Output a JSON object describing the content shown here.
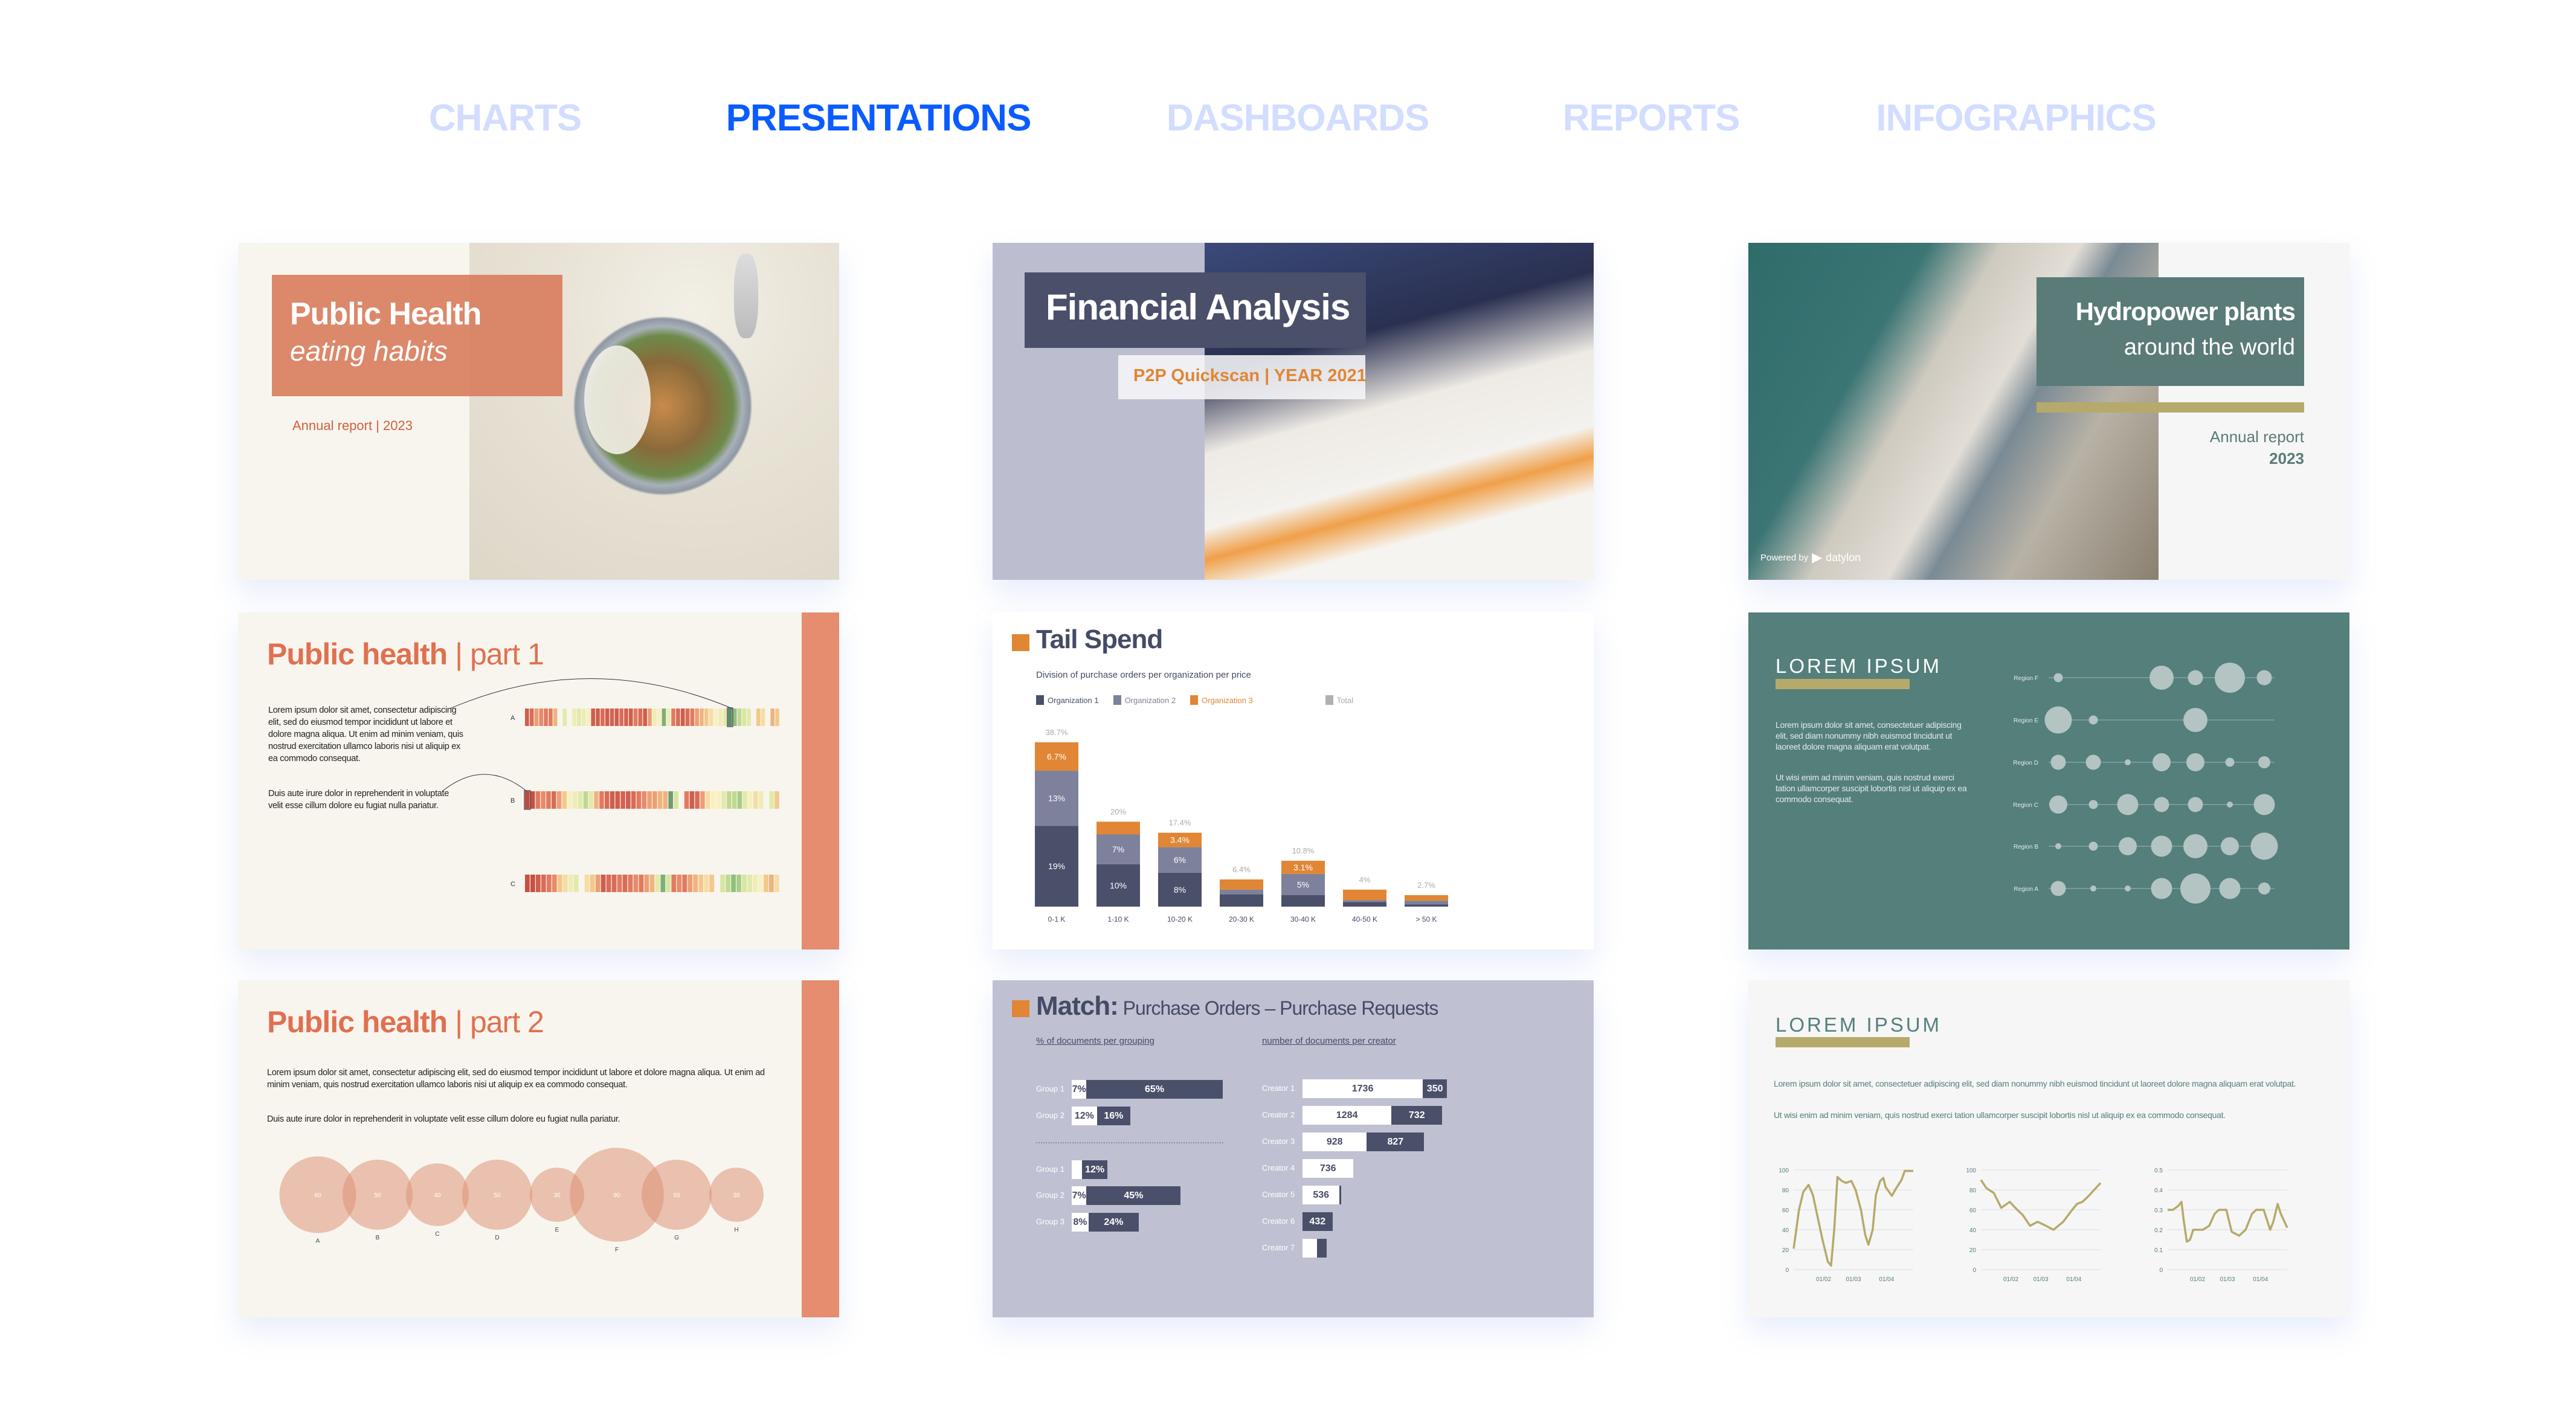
{
  "nav": {
    "tabs": [
      {
        "label": "CHARTS",
        "active": false
      },
      {
        "label": "PRESENTATIONS",
        "active": true
      },
      {
        "label": "DASHBOARDS",
        "active": false
      },
      {
        "label": "REPORTS",
        "active": false
      },
      {
        "label": "INFOGRAPHICS",
        "active": false
      }
    ],
    "active_color": "#0a5cff",
    "inactive_color": "#d2ddff"
  },
  "cards": {
    "public_health_cover": {
      "title": "Public Health",
      "subtitle": "eating habits",
      "footer": "Annual report | 2023",
      "accent": "#d97e5e"
    },
    "financial_analysis": {
      "title": "Financial Analysis",
      "subtitle": "P2P Quickscan | YEAR 2021",
      "accent": "#4a4f6a"
    },
    "hydropower": {
      "title": "Hydropower plants",
      "subtitle": "around the world",
      "report": "Annual report",
      "year": "2023",
      "powered_by": "Powered by",
      "brand": "datylon",
      "accent": "#5a7b77"
    },
    "part1": {
      "title_bold": "Public health",
      "title_rest": " | part 1",
      "paragraphs": [
        "Lorem ipsum dolor sit amet, consectetur adipiscing elit, sed do eiusmod tempor incididunt ut labore et dolore magna aliqua. Ut enim ad minim veniam, quis nostrud exercitation ullamco laboris nisi ut aliquip ex ea commodo consequat.",
        "Duis aute irure dolor in reprehenderit in voluptate velit esse cillum dolore eu fugiat nulla pariatur."
      ]
    },
    "tail_spend": {
      "title": "Tail Spend",
      "subtitle": "Division of purchase orders per organization per price"
    },
    "match": {
      "title_bold": "Match:",
      "title_rest": " Purchase Orders – Purchase Requests",
      "left_heading": "% of documents per grouping",
      "right_heading": "number of documents per creator"
    },
    "lorem_dots": {
      "title": "LOREM IPSUM",
      "paragraphs": [
        "Lorem ipsum dolor sit amet, consectetuer adipiscing elit, sed diam nonummy nibh euismod tincidunt ut laoreet dolore magna aliquam erat volutpat.",
        "Ut wisi enim ad minim veniam, quis nostrud exerci tation ullamcorper suscipit lobortis nisl ut aliquip ex ea commodo consequat."
      ]
    },
    "lorem_lines": {
      "title": "LOREM IPSUM",
      "paragraphs": [
        "Lorem ipsum dolor sit amet, consectetuer adipiscing elit, sed diam nonummy nibh euismod tincidunt ut laoreet dolore magna aliquam erat volutpat.",
        "Ut wisi enim ad minim veniam, quis nostrud exerci tation ullamcorper suscipit lobortis nisl ut aliquip ex ea commodo consequat."
      ]
    },
    "part2": {
      "title_bold": "Public health",
      "title_rest": " | part 2",
      "paragraphs": [
        "Lorem ipsum dolor sit amet, consectetur adipiscing elit, sed do eiusmod tempor incididunt ut labore et dolore magna aliqua. Ut enim ad minim veniam, quis nostrud exercitation ullamco laboris nisi ut aliquip ex ea commodo consequat.",
        "Duis aute irure dolor in reprehenderit in voluptate velit esse cillum dolore eu fugiat nulla pariatur."
      ]
    }
  },
  "chart_data": [
    {
      "id": "heatmap-stripes",
      "type": "heatmap",
      "rows": [
        {
          "label": "A",
          "highlight": 43,
          "values": [
            0.1,
            0.15,
            0.3,
            0.25,
            0.2,
            0.2,
            0.35,
            null,
            0.6,
            null,
            0.55,
            0.6,
            0.55,
            0.5,
            0.1,
            0.1,
            0.15,
            0.1,
            0.12,
            0.1,
            0.15,
            0.12,
            0.1,
            0.2,
            0.15,
            0.1,
            0.3,
            0.55,
            0.5,
            0.85,
            0.55,
            0.2,
            0.15,
            0.1,
            0.15,
            0.2,
            0.3,
            0.35,
            0.4,
            0.45,
            0.5,
            0.55,
            0.6,
            0.95,
            0.8,
            0.7,
            0.65,
            0.6,
            null,
            0.4,
            0.45,
            null,
            0.35,
            0.4
          ]
        },
        {
          "label": "B",
          "highlight": 0,
          "values": [
            0.02,
            0.05,
            0.2,
            0.25,
            0.2,
            0.15,
            0.3,
            0.4,
            0.5,
            0.55,
            0.6,
            0.7,
            0.6,
            0.35,
            0.2,
            0.15,
            0.1,
            0.1,
            0.12,
            0.1,
            0.15,
            0.2,
            0.25,
            0.3,
            0.3,
            0.35,
            0.35,
            0.9,
            0.65,
            null,
            0.2,
            0.1,
            0.15,
            0.3,
            0.45,
            0.5,
            0.5,
            0.6,
            0.7,
            0.7,
            0.75,
            0.6,
            0.5,
            0.45,
            0.55,
            null,
            0.6,
            0.4
          ]
        },
        {
          "label": "C",
          "highlight": null,
          "values": [
            0.05,
            0.05,
            0.1,
            0.15,
            0.2,
            0.25,
            0.4,
            0.45,
            0.55,
            0.6,
            null,
            0.45,
            0.4,
            0.3,
            0.1,
            0.15,
            0.15,
            0.2,
            0.15,
            0.2,
            0.25,
            0.2,
            0.3,
            0.35,
            0.6,
            0.85,
            0.65,
            0.2,
            0.25,
            0.2,
            0.3,
            0.35,
            0.4,
            0.45,
            0.4,
            null,
            0.65,
            0.7,
            0.8,
            0.75,
            0.65,
            0.6,
            0.55,
            0.5,
            0.4,
            0.35,
            0.45
          ]
        }
      ]
    },
    {
      "id": "tail-spend",
      "type": "bar",
      "stacked": true,
      "categories": [
        "0-1 K",
        "1-10 K",
        "10-20 K",
        "20-30 K",
        "30-40 K",
        "40-50 K",
        "> 50 K"
      ],
      "series": [
        {
          "name": "Organization 1",
          "color": "#4a4f6a",
          "values": [
            19,
            10,
            8,
            2.9,
            2.7,
            1.1,
            0.5
          ],
          "labels": [
            "19%",
            "10%",
            "8%",
            "",
            "",
            "",
            ""
          ]
        },
        {
          "name": "Organization 2",
          "color": "#7d819b",
          "values": [
            13,
            7,
            6,
            1.1,
            5,
            0.4,
            0.9
          ],
          "labels": [
            "13%",
            "7%",
            "6%",
            "",
            "5%",
            "",
            ""
          ]
        },
        {
          "name": "Organization 3",
          "color": "#e08634",
          "values": [
            6.7,
            3,
            3.4,
            2.4,
            3.1,
            2.5,
            1.3
          ],
          "labels": [
            "6.7%",
            "",
            "3.4%",
            "",
            "3.1%",
            "",
            ""
          ]
        }
      ],
      "totals": {
        "name": "Total",
        "color": "#b0b0b0",
        "labels": [
          "38.7%",
          "20%",
          "17.4%",
          "6.4%",
          "10.8%",
          "4%",
          "2.7%"
        ]
      },
      "legend": "top"
    },
    {
      "id": "match-groups",
      "type": "bar",
      "orientation": "horizontal",
      "stacked": true,
      "blocks": [
        [
          {
            "label": "Group 1",
            "values": [
              7,
              65
            ],
            "labels": [
              "7%",
              "65%"
            ]
          },
          {
            "label": "Group 2",
            "values": [
              12,
              16
            ],
            "labels": [
              "12%",
              "16%"
            ]
          }
        ],
        [
          {
            "label": "Group 1",
            "values": [
              5,
              12
            ],
            "labels": [
              "",
              "12%"
            ]
          },
          {
            "label": "Group 2",
            "values": [
              7,
              45
            ],
            "labels": [
              "7%",
              "45%"
            ]
          },
          {
            "label": "Group 3",
            "values": [
              8,
              24
            ],
            "labels": [
              "8%",
              "24%"
            ]
          }
        ]
      ]
    },
    {
      "id": "match-creators",
      "type": "bar",
      "orientation": "horizontal",
      "stacked": true,
      "rows": [
        {
          "label": "Creator 1",
          "values": [
            1736,
            350
          ],
          "labels": [
            "1736",
            "350"
          ]
        },
        {
          "label": "Creator 2",
          "values": [
            1284,
            732
          ],
          "labels": [
            "1284",
            "732"
          ]
        },
        {
          "label": "Creator 3",
          "values": [
            928,
            827
          ],
          "labels": [
            "928",
            "827"
          ]
        },
        {
          "label": "Creator 4",
          "values": [
            736,
            0
          ],
          "labels": [
            "736",
            ""
          ]
        },
        {
          "label": "Creator 5",
          "values": [
            536,
            25
          ],
          "labels": [
            "536",
            ""
          ]
        },
        {
          "label": "Creator 6",
          "values": [
            0,
            432
          ],
          "labels": [
            "",
            "432"
          ]
        },
        {
          "label": "Creator 7",
          "values": [
            210,
            135
          ],
          "labels": [
            "",
            ""
          ]
        }
      ]
    },
    {
      "id": "region-dots",
      "type": "scatter",
      "rows": [
        {
          "label": "Region F",
          "values": [
            3,
            null,
            null,
            8,
            5,
            10,
            5
          ]
        },
        {
          "label": "Region E",
          "values": [
            9,
            3,
            null,
            null,
            8,
            null,
            null
          ]
        },
        {
          "label": "Region D",
          "values": [
            5,
            5,
            2,
            6,
            6,
            3,
            4
          ]
        },
        {
          "label": "Region C",
          "values": [
            6,
            3,
            7,
            5,
            5,
            2,
            7
          ]
        },
        {
          "label": "Region B",
          "values": [
            2,
            3,
            6,
            7,
            8,
            6,
            9
          ]
        },
        {
          "label": "Region A",
          "values": [
            5,
            2,
            2,
            7,
            10,
            7,
            4
          ]
        }
      ],
      "color": "#b3c4c2"
    },
    {
      "id": "line-1",
      "type": "line",
      "ylim": [
        0,
        100
      ],
      "yticks": [
        "0",
        "20",
        "40",
        "60",
        "80",
        "100"
      ],
      "xticks": [
        "01/02",
        "01/03",
        "01/04"
      ],
      "color": "#b5aa6b",
      "grid": true,
      "points": [
        [
          "04/01",
          21
        ],
        [
          "09/01",
          60
        ],
        [
          "13/01",
          78
        ],
        [
          "18/01",
          85
        ],
        [
          "22/01",
          75
        ],
        [
          "26/01",
          55
        ],
        [
          "31/01",
          30
        ],
        [
          "05/02",
          8
        ],
        [
          "08/02",
          4
        ],
        [
          "11/02",
          40
        ],
        [
          "14/02",
          93
        ],
        [
          "18/02",
          89
        ],
        [
          "22/02",
          87
        ],
        [
          "27/02",
          89
        ],
        [
          "03/03",
          80
        ],
        [
          "08/03",
          60
        ],
        [
          "12/03",
          35
        ],
        [
          "15/03",
          25
        ],
        [
          "19/03",
          40
        ],
        [
          "22/03",
          75
        ],
        [
          "26/03",
          89
        ],
        [
          "29/03",
          92
        ],
        [
          "31/03",
          83
        ],
        [
          "06/04",
          74
        ],
        [
          "09/04",
          80
        ],
        [
          "15/04",
          90
        ],
        [
          "18/04",
          99
        ],
        [
          "26/04",
          99
        ]
      ]
    },
    {
      "id": "line-2",
      "type": "line",
      "ylim": [
        0,
        100
      ],
      "yticks": [
        "0",
        "20",
        "40",
        "60",
        "80",
        "100"
      ],
      "xticks": [
        "01/02",
        "01/03",
        "01/04"
      ],
      "color": "#b5aa6b",
      "grid": true,
      "points": [
        [
          "04/01",
          90
        ],
        [
          "09/01",
          82
        ],
        [
          "13/01",
          79
        ],
        [
          "16/01",
          77
        ],
        [
          "23/01",
          62
        ],
        [
          "31/01",
          68
        ],
        [
          "07/02",
          60
        ],
        [
          "12/02",
          55
        ],
        [
          "19/02",
          44
        ],
        [
          "26/02",
          48
        ],
        [
          "04/03",
          45
        ],
        [
          "13/03",
          40
        ],
        [
          "22/03",
          48
        ],
        [
          "29/03",
          58
        ],
        [
          "04/04",
          66
        ],
        [
          "09/04",
          68
        ],
        [
          "14/04",
          73
        ],
        [
          "20/04",
          80
        ],
        [
          "26/04",
          87
        ]
      ]
    },
    {
      "id": "line-3",
      "type": "line",
      "ylim": [
        0,
        0.5
      ],
      "yticks": [
        "0",
        "0.1",
        "0.2",
        "0.3",
        "0.4",
        "0.5"
      ],
      "xticks": [
        "01/02",
        "01/03",
        "01/04"
      ],
      "color": "#b5aa6b",
      "grid": true,
      "points": [
        [
          "04/01",
          0.3
        ],
        [
          "09/01",
          0.3
        ],
        [
          "14/01",
          0.32
        ],
        [
          "17/01",
          0.34
        ],
        [
          "19/01",
          0.25
        ],
        [
          "22/01",
          0.14
        ],
        [
          "25/01",
          0.15
        ],
        [
          "28/01",
          0.2
        ],
        [
          "06/02",
          0.2
        ],
        [
          "12/02",
          0.22
        ],
        [
          "17/02",
          0.28
        ],
        [
          "21/02",
          0.3
        ],
        [
          "28/02",
          0.3
        ],
        [
          "05/03",
          0.19
        ],
        [
          "12/03",
          0.17
        ],
        [
          "18/03",
          0.2
        ],
        [
          "24/03",
          0.28
        ],
        [
          "28/03",
          0.3
        ],
        [
          "04/04",
          0.3
        ],
        [
          "10/04",
          0.2
        ],
        [
          "13/04",
          0.24
        ],
        [
          "17/04",
          0.33
        ],
        [
          "20/04",
          0.28
        ],
        [
          "26/04",
          0.21
        ]
      ]
    },
    {
      "id": "bubbles",
      "type": "scatter",
      "categories": [
        "A",
        "B",
        "C",
        "D",
        "E",
        "F",
        "G",
        "H"
      ],
      "values": [
        60,
        50,
        40,
        50,
        30,
        90,
        50,
        30
      ],
      "color": "#dc8c6e"
    }
  ]
}
